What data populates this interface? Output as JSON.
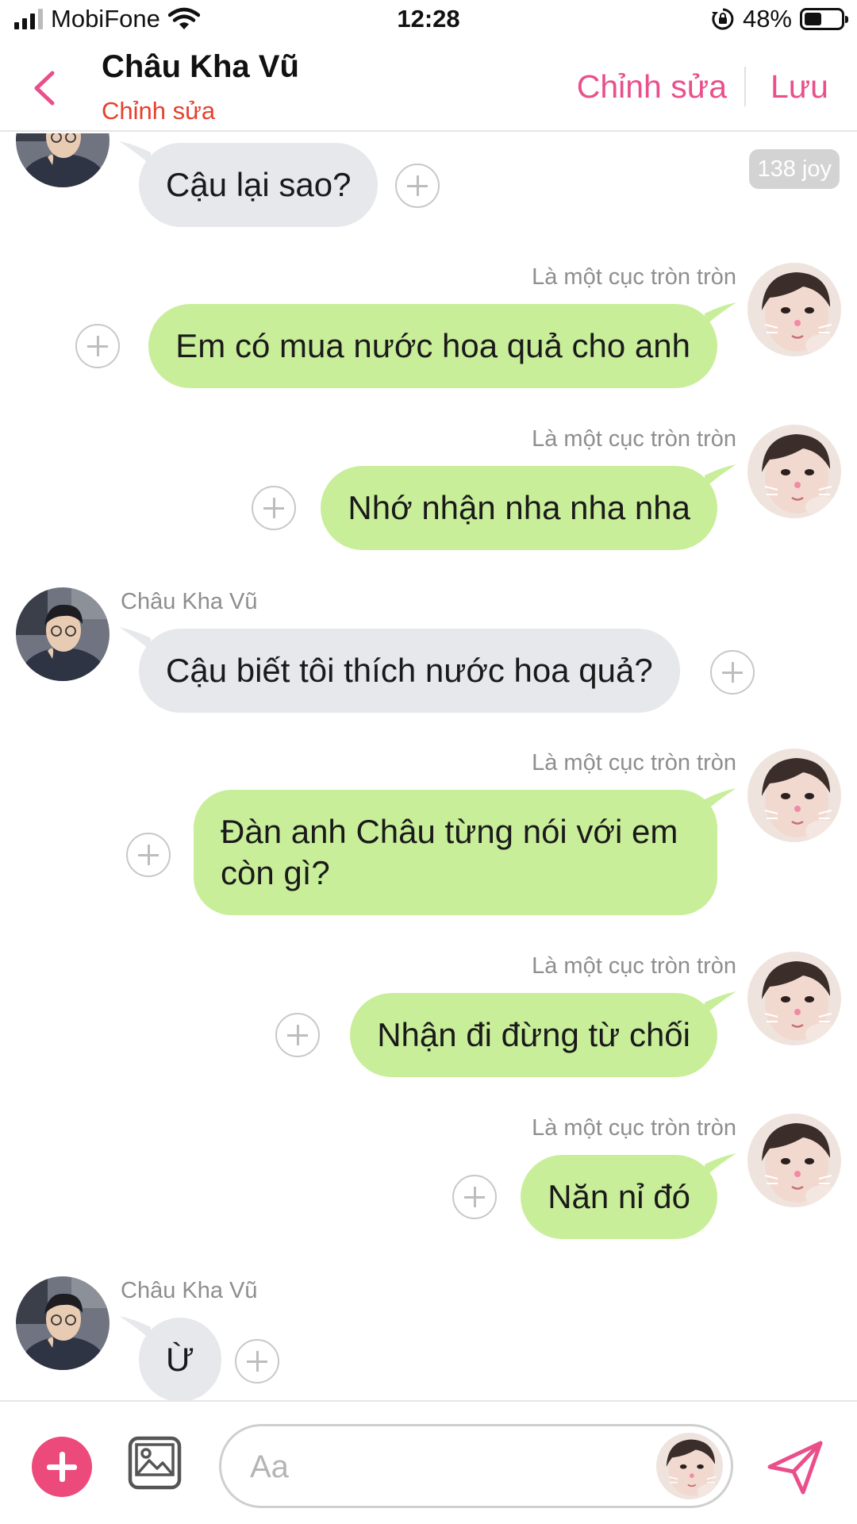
{
  "status_bar": {
    "carrier": "MobiFone",
    "time": "12:28",
    "battery_percent": "48%",
    "battery_level": 0.48,
    "icons": [
      "signal-bars-icon",
      "wifi-icon",
      "rotation-lock-icon",
      "battery-icon"
    ]
  },
  "header": {
    "back_icon": "chevron-left-icon",
    "title": "Châu Kha Vũ",
    "subtitle": "Chỉnh sửa",
    "edit_label": "Chỉnh sửa",
    "save_label": "Lưu"
  },
  "badge": {
    "text": "138 joy"
  },
  "messages": [
    {
      "side": "left",
      "sender": "",
      "text": "Cậu lại sao?"
    },
    {
      "side": "right",
      "sender": "Là một cục tròn tròn",
      "text": "Em có mua nước hoa quả cho anh"
    },
    {
      "side": "right",
      "sender": "Là một cục tròn tròn",
      "text": "Nhớ nhận nha nha nha"
    },
    {
      "side": "left",
      "sender": "Châu Kha Vũ",
      "text": "Cậu biết tôi thích nước hoa quả?"
    },
    {
      "side": "right",
      "sender": "Là một cục tròn tròn",
      "text": "Đàn anh Châu từng nói với em còn gì?"
    },
    {
      "side": "right",
      "sender": "Là một cục tròn tròn",
      "text": "Nhận đi đừng từ chối"
    },
    {
      "side": "right",
      "sender": "Là một cục tròn tròn",
      "text": "Năn nỉ đó"
    },
    {
      "side": "left",
      "sender": "Châu Kha Vũ",
      "text": "Ừ"
    }
  ],
  "composer": {
    "placeholder": "Aa",
    "add_icon": "plus-icon",
    "image_icon": "image-icon",
    "send_icon": "send-icon"
  },
  "colors": {
    "accent": "#ea4f8b",
    "subtitle_red": "#e5412d",
    "bubble_left": "#e6e8ec",
    "bubble_right": "#c9ee9a"
  }
}
